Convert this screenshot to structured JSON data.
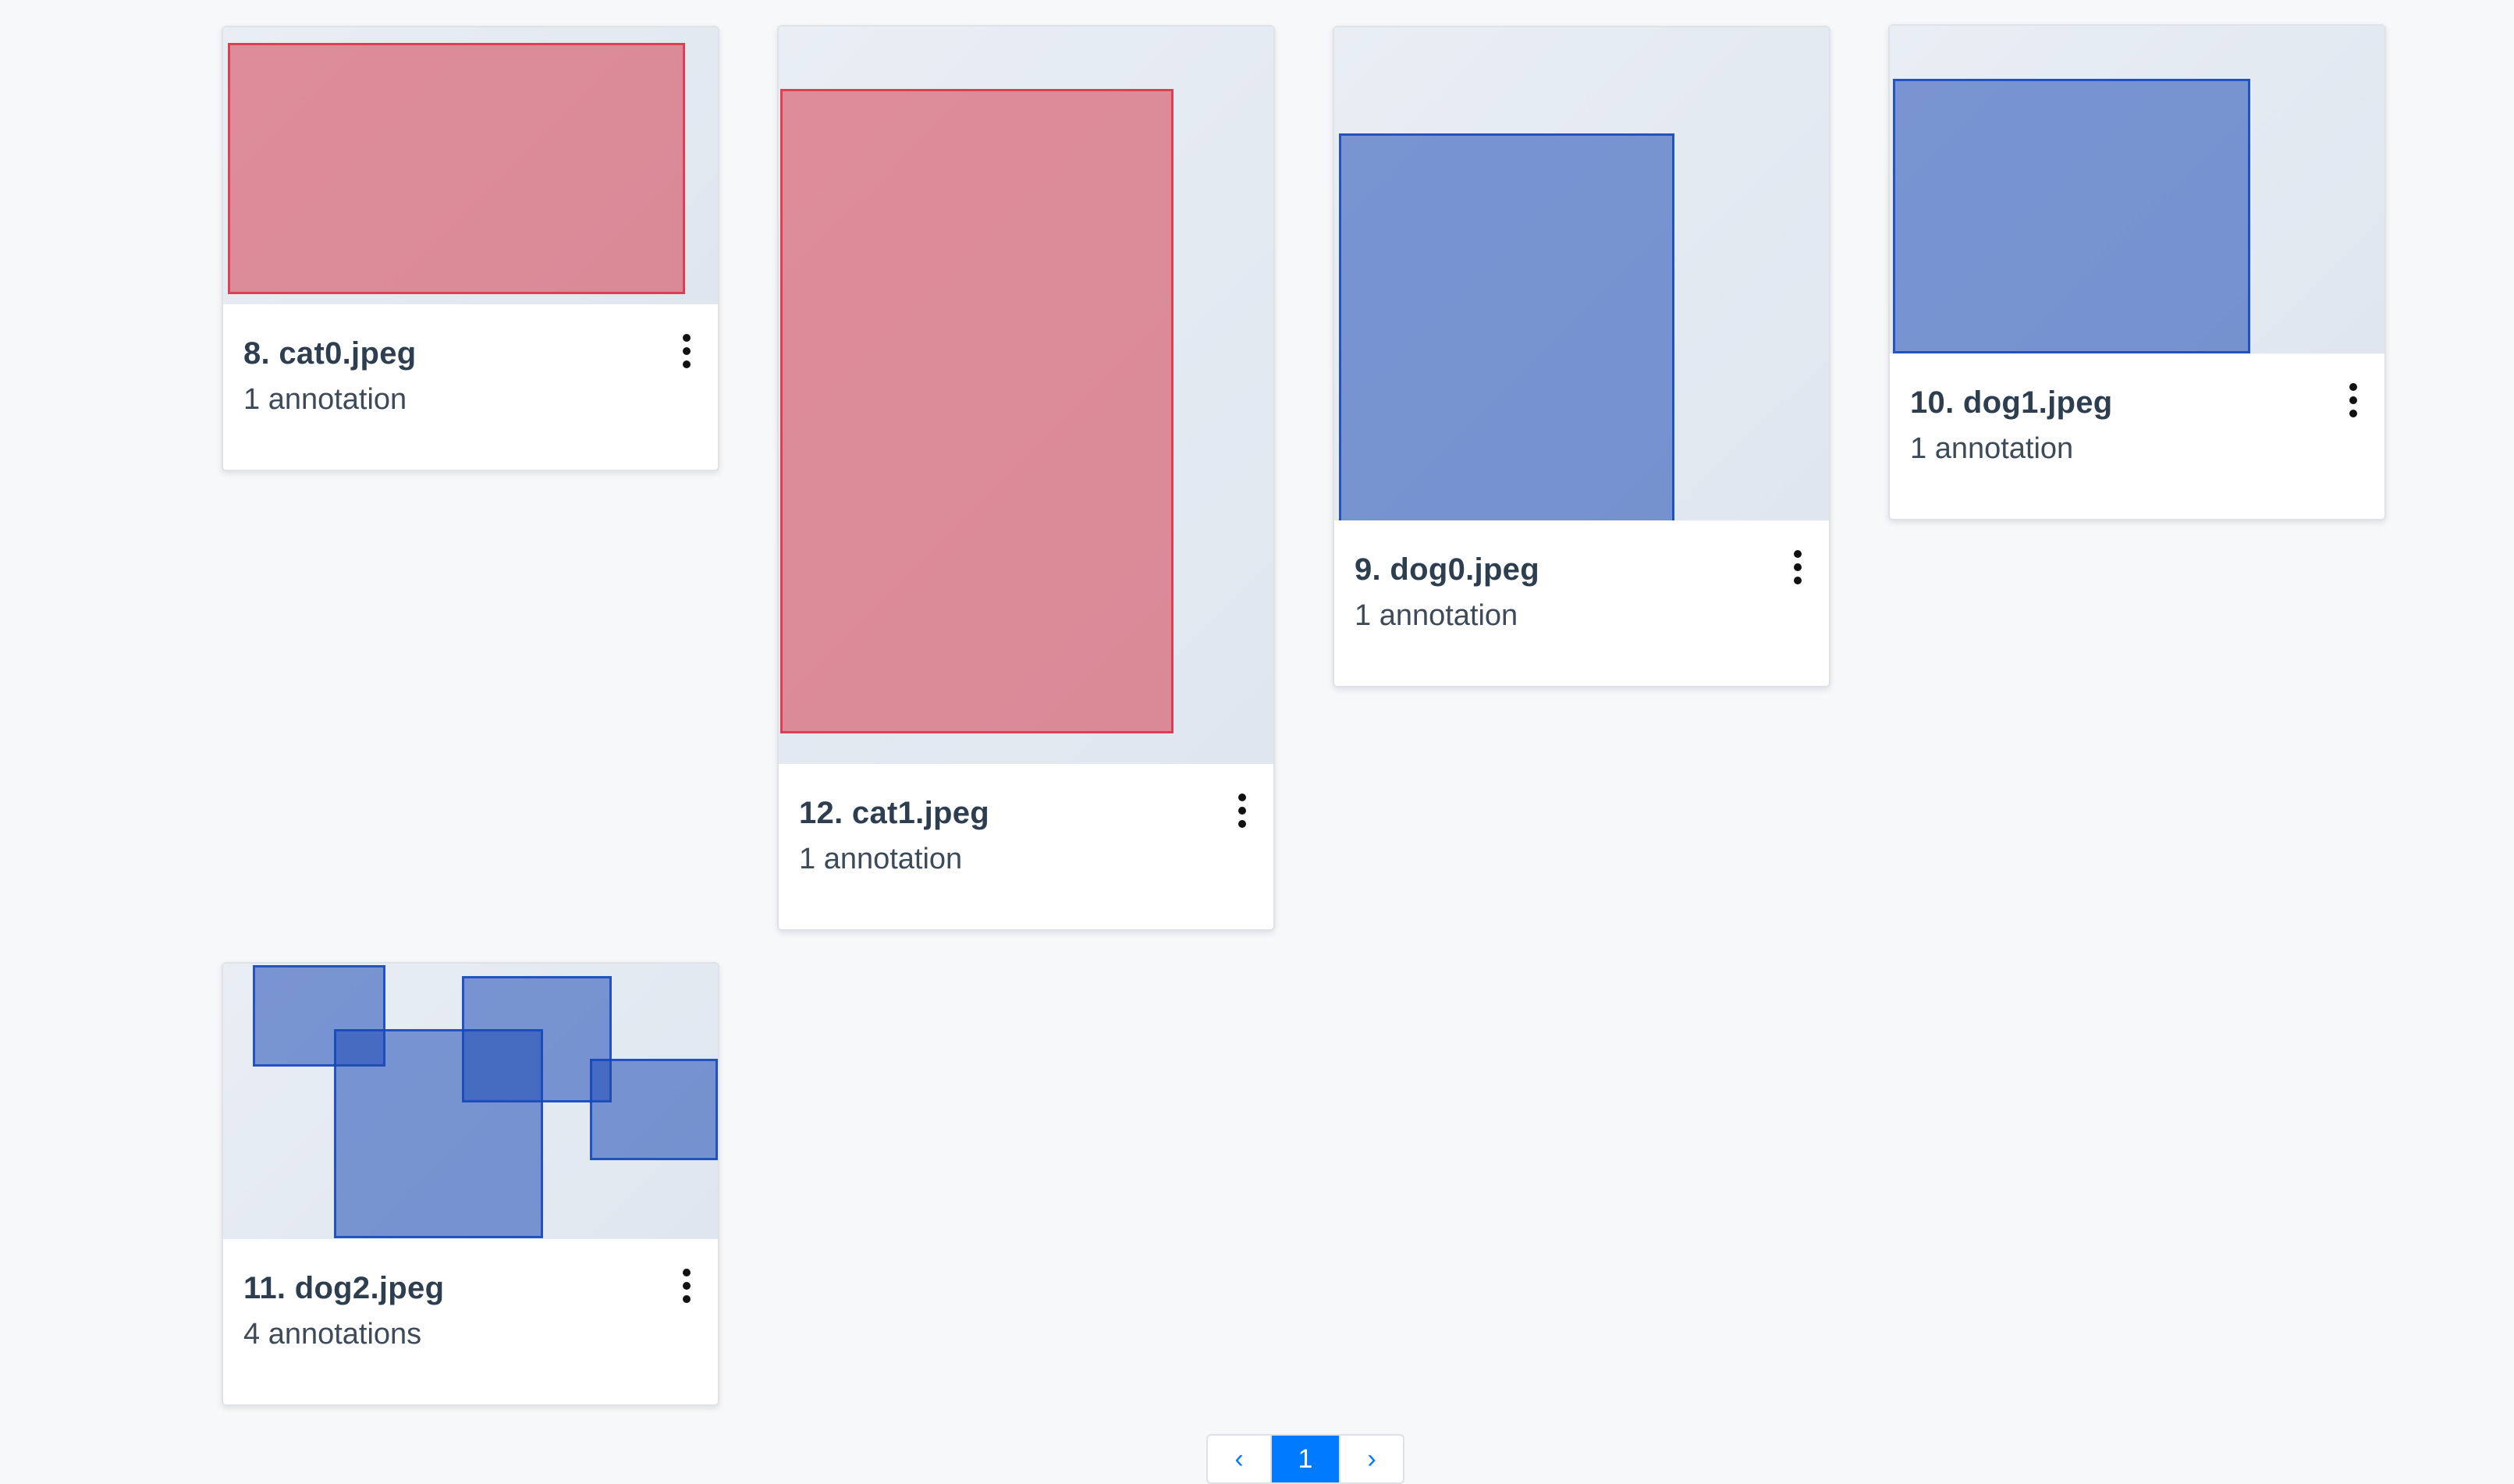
{
  "cards": [
    {
      "title": "8. cat0.jpeg",
      "count": "1 annotation",
      "color": "#d63c4e"
    },
    {
      "title": "12. cat1.jpeg",
      "count": "1 annotation",
      "color": "#d63c4e"
    },
    {
      "title": "9. dog0.jpeg",
      "count": "1 annotation",
      "color": "#1e4bb4"
    },
    {
      "title": "10. dog1.jpeg",
      "count": "1 annotation",
      "color": "#1e4bb4"
    },
    {
      "title": "11. dog2.jpeg",
      "count": "4 annotations",
      "color": "#1e4bb4"
    }
  ],
  "pagination": {
    "prev": "‹",
    "current": "1",
    "next": "›"
  },
  "icons": {
    "card_menu": "kebab-menu-icon"
  }
}
